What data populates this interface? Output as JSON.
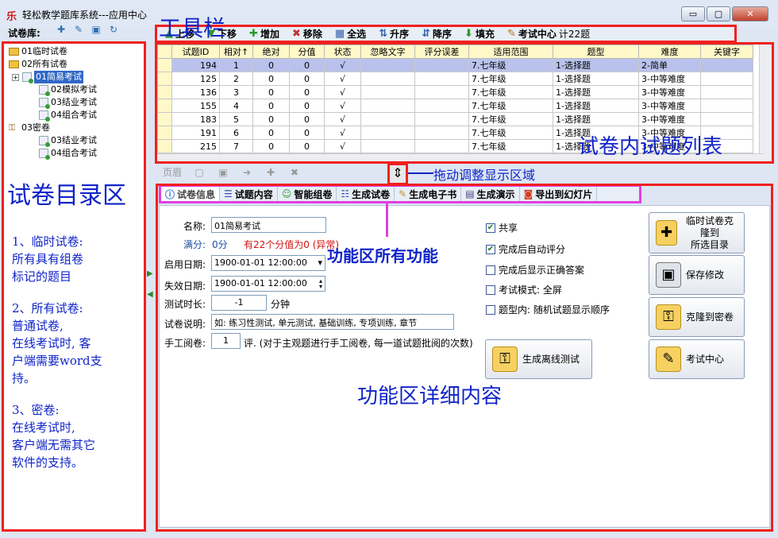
{
  "window": {
    "app_icon": "乐",
    "title": "轻松教学题库系统---应用中心",
    "btn_min": "▭",
    "btn_max": "▢",
    "btn_close": "✕"
  },
  "library": {
    "label": "试卷库:",
    "tools": [
      "new-paper-icon",
      "edit-paper-icon",
      "folder-icon",
      "refresh-icon"
    ]
  },
  "tree": {
    "items": [
      {
        "label": "01临时试卷",
        "icon": "folder-icon"
      },
      {
        "label": "02所有试卷",
        "icon": "folder-icon"
      },
      {
        "label": "01简易考试",
        "icon": "doc-icon",
        "selected": true
      },
      {
        "label": "02模拟考试",
        "icon": "doc-icon"
      },
      {
        "label": "03结业考试",
        "icon": "doc-icon"
      },
      {
        "label": "04组合考试",
        "icon": "doc-icon"
      },
      {
        "label": "03密卷",
        "icon": "key-icon"
      },
      {
        "label": "03结业考试",
        "icon": "doc-icon"
      },
      {
        "label": "04组合考试",
        "icon": "doc-icon"
      }
    ]
  },
  "annotations": {
    "sidebar_title": "试卷目录区",
    "note1": "1、临时试卷:\n  所有具有组卷\n标记的题目",
    "note2": "2、所有试卷:\n  普通试卷,\n在线考试时, 客\n户端需要word支\n持。",
    "note3": "3、密卷:\n  在线考试时,\n客户端无需其它\n软件的支持。",
    "toolbar": "工具栏",
    "grid": "试卷内试题列表",
    "splitter": "拖动调整显示区域",
    "functions": "功能区所有功能",
    "detail": "功能区详细内容"
  },
  "toolbar": {
    "items": [
      {
        "icon": "▲",
        "label": "上移"
      },
      {
        "icon": "▼",
        "label": "下移"
      },
      {
        "icon": "✚",
        "label": "增加"
      },
      {
        "icon": "✖",
        "label": "移除"
      },
      {
        "icon": "▦",
        "label": "全选"
      },
      {
        "icon": "⇅",
        "label": "升序"
      },
      {
        "icon": "⇵",
        "label": "降序"
      },
      {
        "icon": "⬇",
        "label": "填充"
      },
      {
        "icon": "✎",
        "label": "考试中心"
      }
    ],
    "count": "计22题"
  },
  "grid": {
    "columns": [
      "试题ID",
      "相对↑",
      "绝对",
      "分值",
      "状态",
      "忽略文字",
      "评分误差",
      "适用范围",
      "题型",
      "难度",
      "关键字"
    ],
    "rows": [
      [
        "194",
        "1",
        "0",
        "0",
        "√",
        "",
        "",
        "7.七年级",
        "1-选择题",
        "2-简单",
        ""
      ],
      [
        "125",
        "2",
        "0",
        "0",
        "√",
        "",
        "",
        "7.七年级",
        "1-选择题",
        "3-中等难度",
        ""
      ],
      [
        "136",
        "3",
        "0",
        "0",
        "√",
        "",
        "",
        "7.七年级",
        "1-选择题",
        "3-中等难度",
        ""
      ],
      [
        "155",
        "4",
        "0",
        "0",
        "√",
        "",
        "",
        "7.七年级",
        "1-选择题",
        "3-中等难度",
        ""
      ],
      [
        "183",
        "5",
        "0",
        "0",
        "√",
        "",
        "",
        "7.七年级",
        "1-选择题",
        "3-中等难度",
        ""
      ],
      [
        "191",
        "6",
        "0",
        "0",
        "√",
        "",
        "",
        "7.七年级",
        "1-选择题",
        "3-中等难度",
        ""
      ],
      [
        "215",
        "7",
        "0",
        "0",
        "√",
        "",
        "",
        "7.七年级",
        "1-选择题",
        "3-中等难度",
        ""
      ]
    ]
  },
  "pagebar": {
    "label": "页眉"
  },
  "tabs": [
    {
      "icon": "ⓘ",
      "label": "试卷信息"
    },
    {
      "icon": "☰",
      "label": "试题内容"
    },
    {
      "icon": "☺",
      "label": "智能组卷"
    },
    {
      "icon": "☷",
      "label": "生成试卷"
    },
    {
      "icon": "✎",
      "label": "生成电子书"
    },
    {
      "icon": "▤",
      "label": "生成演示"
    },
    {
      "icon": "◙",
      "label": "导出到幻灯片"
    }
  ],
  "form": {
    "name_label": "名称:",
    "name_value": "01简易考试",
    "full_label": "满分:",
    "full_value": "0分",
    "full_warning": "有22个分值为0 (异常)",
    "start_label": "启用日期:",
    "start_value": "1900-01-01 12:00:00",
    "end_label": "失效日期:",
    "end_value": "1900-01-01 12:00:00",
    "duration_label": "测试时长:",
    "duration_value": "-1",
    "duration_unit": "分钟",
    "desc_label": "试卷说明:",
    "desc_value": "如: 练习性测试, 单元测试, 基础训练, 专项训练, 章节",
    "manual_label": "手工阅卷:",
    "manual_value": "1",
    "manual_note": "评. (对于主观题进行手工阅卷, 每一道试题批阅的次数)"
  },
  "options": [
    {
      "label": "共享",
      "checked": true
    },
    {
      "label": "完成后自动评分",
      "checked": true
    },
    {
      "label": "完成后显示正确答案",
      "checked": false
    },
    {
      "label": "考试模式: 全屏",
      "checked": false
    },
    {
      "label": "题型内: 随机试题显示顺序",
      "checked": false
    }
  ],
  "buttons": {
    "offline": "生成离线测试",
    "clone_temp": "临时试卷克隆到\n所选目录",
    "save": "保存修改",
    "clone_secret": "克隆到密卷",
    "exam_center": "考试中心"
  }
}
